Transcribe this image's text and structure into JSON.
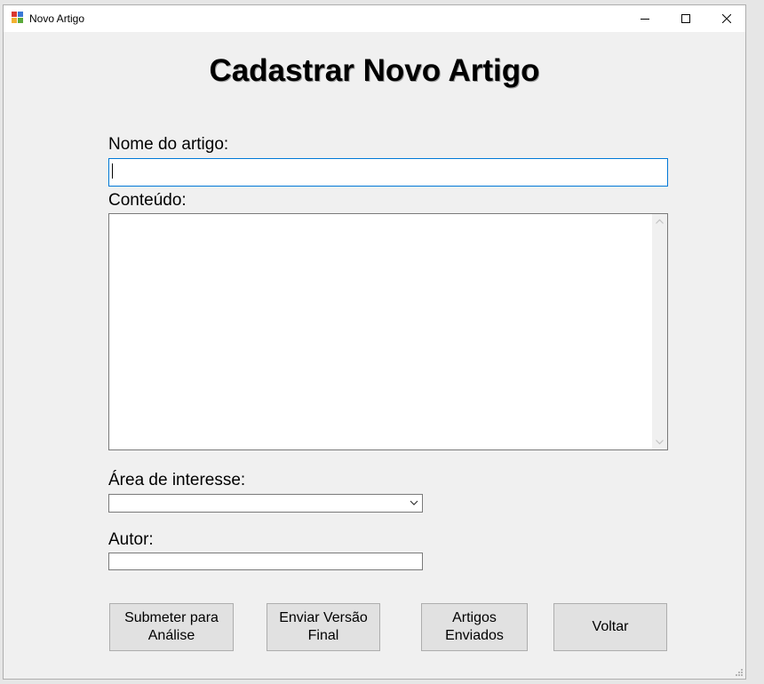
{
  "window": {
    "title": "Novo Artigo",
    "controls": {
      "minimize": "minimize-icon",
      "maximize": "maximize-icon",
      "close": "close-icon"
    }
  },
  "form": {
    "heading": "Cadastrar Novo Artigo",
    "name_label": "Nome do artigo:",
    "name_value": "",
    "content_label": "Conteúdo:",
    "content_value": "",
    "area_label": "Área de interesse:",
    "area_selected": "",
    "author_label": "Autor:",
    "author_value": ""
  },
  "buttons": {
    "submit_line1": "Submeter para",
    "submit_line2": "Análise",
    "final_line1": "Enviar Versão",
    "final_line2": "Final",
    "sent_line1": "Artigos",
    "sent_line2": "Enviados",
    "back": "Voltar"
  },
  "colors": {
    "window_bg": "#f0f0f0",
    "focus_border": "#0078d7",
    "button_bg": "#e1e1e1"
  }
}
